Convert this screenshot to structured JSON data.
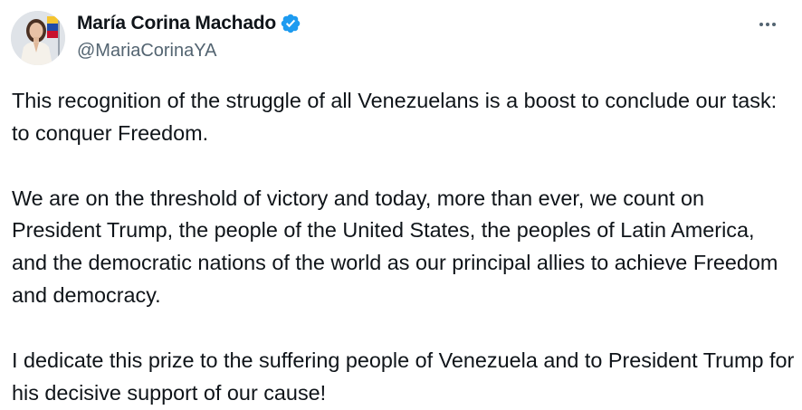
{
  "author": {
    "display_name": "María Corina Machado",
    "handle": "@MariaCorinaYA",
    "verified": true,
    "verified_color": "#1d9bf0"
  },
  "icons": {
    "verified": "verified-badge-icon",
    "more": "more-options-icon"
  },
  "tweet": {
    "paragraphs": [
      "This recognition of the struggle of all Venezuelans is a boost to conclude our task: to conquer Freedom.",
      "We are on the threshold of victory and today, more than ever, we count on President Trump, the people of the United States, the peoples of Latin America, and the democratic nations of the world as our principal allies to achieve Freedom and democracy.",
      "I dedicate this prize to the suffering people of Venezuela and to President Trump for his decisive support of our cause!"
    ]
  }
}
